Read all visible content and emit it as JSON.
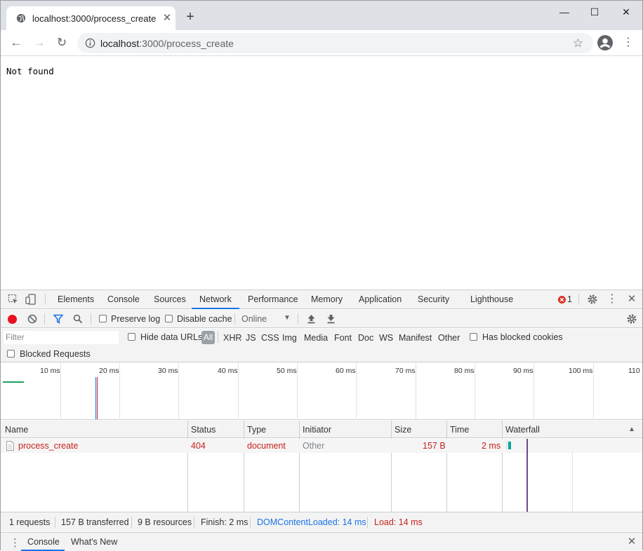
{
  "tab": {
    "title": "localhost:3000/process_create",
    "close": "✕",
    "newtab": "+"
  },
  "window_controls": {
    "minimize": "—",
    "maximize": "☐",
    "close": "✕"
  },
  "toolbar": {
    "back": "←",
    "forward": "→",
    "reload": "↻",
    "url_host": "localhost",
    "url_path": ":3000/process_create",
    "star": "☆",
    "menu": "⋮"
  },
  "page": {
    "body_text": "Not found"
  },
  "devtools": {
    "tabs": [
      "Elements",
      "Console",
      "Sources",
      "Network",
      "Performance",
      "Memory",
      "Application",
      "Security",
      "Lighthouse"
    ],
    "active_tab": "Network",
    "error_count": "1",
    "network_toolbar": {
      "preserve_log": "Preserve log",
      "disable_cache": "Disable cache",
      "throttle": "Online"
    },
    "filter": {
      "placeholder": "Filter",
      "hide_data_urls": "Hide data URLs",
      "all": "All",
      "types": [
        "XHR",
        "JS",
        "CSS",
        "Img",
        "Media",
        "Font",
        "Doc",
        "WS",
        "Manifest",
        "Other"
      ],
      "has_blocked_cookies": "Has blocked cookies",
      "blocked_requests": "Blocked Requests"
    },
    "overview_ticks": [
      "10 ms",
      "20 ms",
      "30 ms",
      "40 ms",
      "50 ms",
      "60 ms",
      "70 ms",
      "80 ms",
      "90 ms",
      "100 ms",
      "110"
    ],
    "columns": [
      "Name",
      "Status",
      "Type",
      "Initiator",
      "Size",
      "Time",
      "Waterfall"
    ],
    "requests": [
      {
        "name": "process_create",
        "status": "404",
        "type": "document",
        "initiator": "Other",
        "size": "157 B",
        "time": "2 ms"
      }
    ],
    "status": {
      "requests": "1 requests",
      "transferred": "157 B transferred",
      "resources": "9 B resources",
      "finish": "Finish: 2 ms",
      "dom_content_loaded": "DOMContentLoaded: 14 ms",
      "load": "Load: 14 ms"
    },
    "drawer": {
      "tabs": [
        "Console",
        "What's New"
      ],
      "active": "Console"
    }
  },
  "colors": {
    "accent": "#1a73e8",
    "error": "#c5221f",
    "record": "#e8111e"
  }
}
